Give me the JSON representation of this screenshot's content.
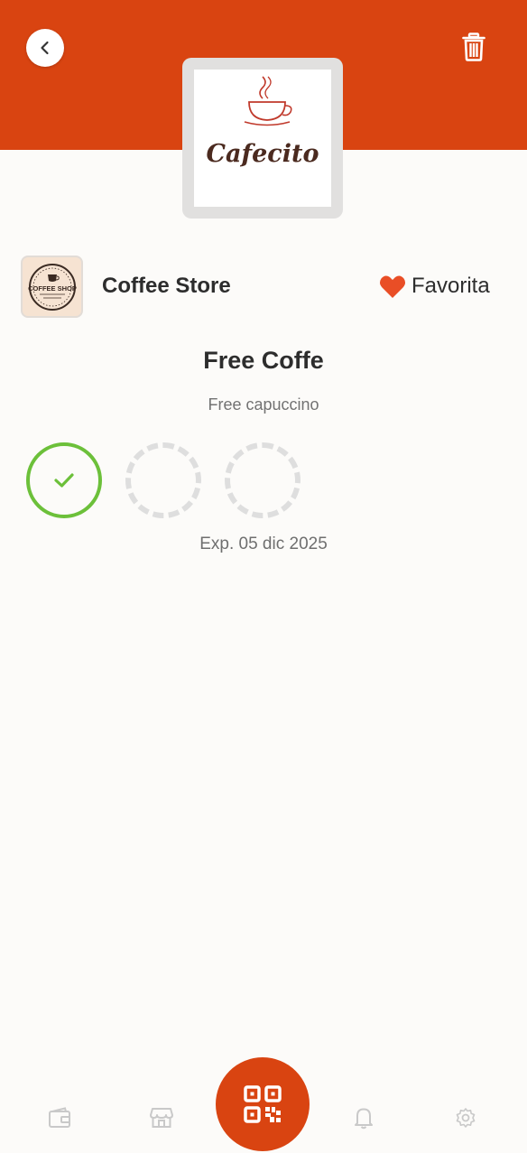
{
  "header": {
    "back_icon": "chevron-left-icon",
    "delete_icon": "trash-icon",
    "brand_color": "#d94411"
  },
  "card_logo": {
    "brand_text": "Cafecito"
  },
  "store": {
    "name": "Coffee Store",
    "avatar_text": "COFFEE SHOP",
    "favorite_label": "Favorita",
    "favorite_icon": "heart-icon",
    "favorite_color": "#e94e26"
  },
  "reward": {
    "title": "Free Coffe",
    "description": "Free capuccino",
    "stamps_collected": 1,
    "stamps_total": 3,
    "expiry": "Exp. 05 dic 2025",
    "stamp_done_color": "#6cc03a"
  },
  "bottom_nav": {
    "items": [
      {
        "icon": "wallet-icon"
      },
      {
        "icon": "store-icon"
      },
      {
        "icon": "qr-code-icon"
      },
      {
        "icon": "bell-icon"
      },
      {
        "icon": "gear-icon"
      }
    ]
  }
}
